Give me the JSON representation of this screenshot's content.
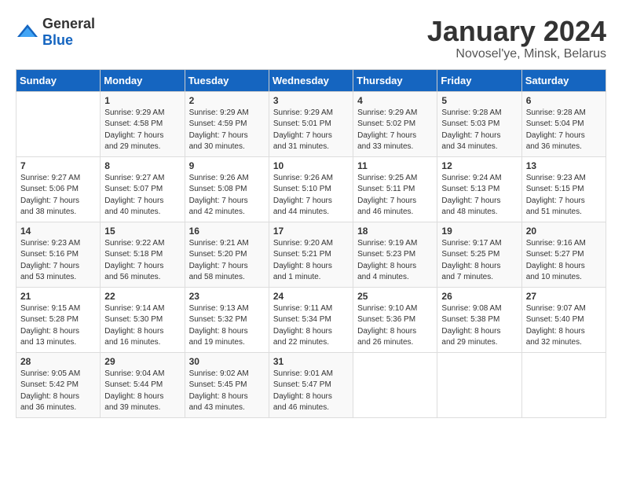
{
  "logo": {
    "general": "General",
    "blue": "Blue"
  },
  "header": {
    "month": "January 2024",
    "location": "Novosel'ye, Minsk, Belarus"
  },
  "weekdays": [
    "Sunday",
    "Monday",
    "Tuesday",
    "Wednesday",
    "Thursday",
    "Friday",
    "Saturday"
  ],
  "weeks": [
    [
      {
        "day": "",
        "info": ""
      },
      {
        "day": "1",
        "info": "Sunrise: 9:29 AM\nSunset: 4:58 PM\nDaylight: 7 hours\nand 29 minutes."
      },
      {
        "day": "2",
        "info": "Sunrise: 9:29 AM\nSunset: 4:59 PM\nDaylight: 7 hours\nand 30 minutes."
      },
      {
        "day": "3",
        "info": "Sunrise: 9:29 AM\nSunset: 5:01 PM\nDaylight: 7 hours\nand 31 minutes."
      },
      {
        "day": "4",
        "info": "Sunrise: 9:29 AM\nSunset: 5:02 PM\nDaylight: 7 hours\nand 33 minutes."
      },
      {
        "day": "5",
        "info": "Sunrise: 9:28 AM\nSunset: 5:03 PM\nDaylight: 7 hours\nand 34 minutes."
      },
      {
        "day": "6",
        "info": "Sunrise: 9:28 AM\nSunset: 5:04 PM\nDaylight: 7 hours\nand 36 minutes."
      }
    ],
    [
      {
        "day": "7",
        "info": "Sunrise: 9:27 AM\nSunset: 5:06 PM\nDaylight: 7 hours\nand 38 minutes."
      },
      {
        "day": "8",
        "info": "Sunrise: 9:27 AM\nSunset: 5:07 PM\nDaylight: 7 hours\nand 40 minutes."
      },
      {
        "day": "9",
        "info": "Sunrise: 9:26 AM\nSunset: 5:08 PM\nDaylight: 7 hours\nand 42 minutes."
      },
      {
        "day": "10",
        "info": "Sunrise: 9:26 AM\nSunset: 5:10 PM\nDaylight: 7 hours\nand 44 minutes."
      },
      {
        "day": "11",
        "info": "Sunrise: 9:25 AM\nSunset: 5:11 PM\nDaylight: 7 hours\nand 46 minutes."
      },
      {
        "day": "12",
        "info": "Sunrise: 9:24 AM\nSunset: 5:13 PM\nDaylight: 7 hours\nand 48 minutes."
      },
      {
        "day": "13",
        "info": "Sunrise: 9:23 AM\nSunset: 5:15 PM\nDaylight: 7 hours\nand 51 minutes."
      }
    ],
    [
      {
        "day": "14",
        "info": "Sunrise: 9:23 AM\nSunset: 5:16 PM\nDaylight: 7 hours\nand 53 minutes."
      },
      {
        "day": "15",
        "info": "Sunrise: 9:22 AM\nSunset: 5:18 PM\nDaylight: 7 hours\nand 56 minutes."
      },
      {
        "day": "16",
        "info": "Sunrise: 9:21 AM\nSunset: 5:20 PM\nDaylight: 7 hours\nand 58 minutes."
      },
      {
        "day": "17",
        "info": "Sunrise: 9:20 AM\nSunset: 5:21 PM\nDaylight: 8 hours\nand 1 minute."
      },
      {
        "day": "18",
        "info": "Sunrise: 9:19 AM\nSunset: 5:23 PM\nDaylight: 8 hours\nand 4 minutes."
      },
      {
        "day": "19",
        "info": "Sunrise: 9:17 AM\nSunset: 5:25 PM\nDaylight: 8 hours\nand 7 minutes."
      },
      {
        "day": "20",
        "info": "Sunrise: 9:16 AM\nSunset: 5:27 PM\nDaylight: 8 hours\nand 10 minutes."
      }
    ],
    [
      {
        "day": "21",
        "info": "Sunrise: 9:15 AM\nSunset: 5:28 PM\nDaylight: 8 hours\nand 13 minutes."
      },
      {
        "day": "22",
        "info": "Sunrise: 9:14 AM\nSunset: 5:30 PM\nDaylight: 8 hours\nand 16 minutes."
      },
      {
        "day": "23",
        "info": "Sunrise: 9:13 AM\nSunset: 5:32 PM\nDaylight: 8 hours\nand 19 minutes."
      },
      {
        "day": "24",
        "info": "Sunrise: 9:11 AM\nSunset: 5:34 PM\nDaylight: 8 hours\nand 22 minutes."
      },
      {
        "day": "25",
        "info": "Sunrise: 9:10 AM\nSunset: 5:36 PM\nDaylight: 8 hours\nand 26 minutes."
      },
      {
        "day": "26",
        "info": "Sunrise: 9:08 AM\nSunset: 5:38 PM\nDaylight: 8 hours\nand 29 minutes."
      },
      {
        "day": "27",
        "info": "Sunrise: 9:07 AM\nSunset: 5:40 PM\nDaylight: 8 hours\nand 32 minutes."
      }
    ],
    [
      {
        "day": "28",
        "info": "Sunrise: 9:05 AM\nSunset: 5:42 PM\nDaylight: 8 hours\nand 36 minutes."
      },
      {
        "day": "29",
        "info": "Sunrise: 9:04 AM\nSunset: 5:44 PM\nDaylight: 8 hours\nand 39 minutes."
      },
      {
        "day": "30",
        "info": "Sunrise: 9:02 AM\nSunset: 5:45 PM\nDaylight: 8 hours\nand 43 minutes."
      },
      {
        "day": "31",
        "info": "Sunrise: 9:01 AM\nSunset: 5:47 PM\nDaylight: 8 hours\nand 46 minutes."
      },
      {
        "day": "",
        "info": ""
      },
      {
        "day": "",
        "info": ""
      },
      {
        "day": "",
        "info": ""
      }
    ]
  ]
}
